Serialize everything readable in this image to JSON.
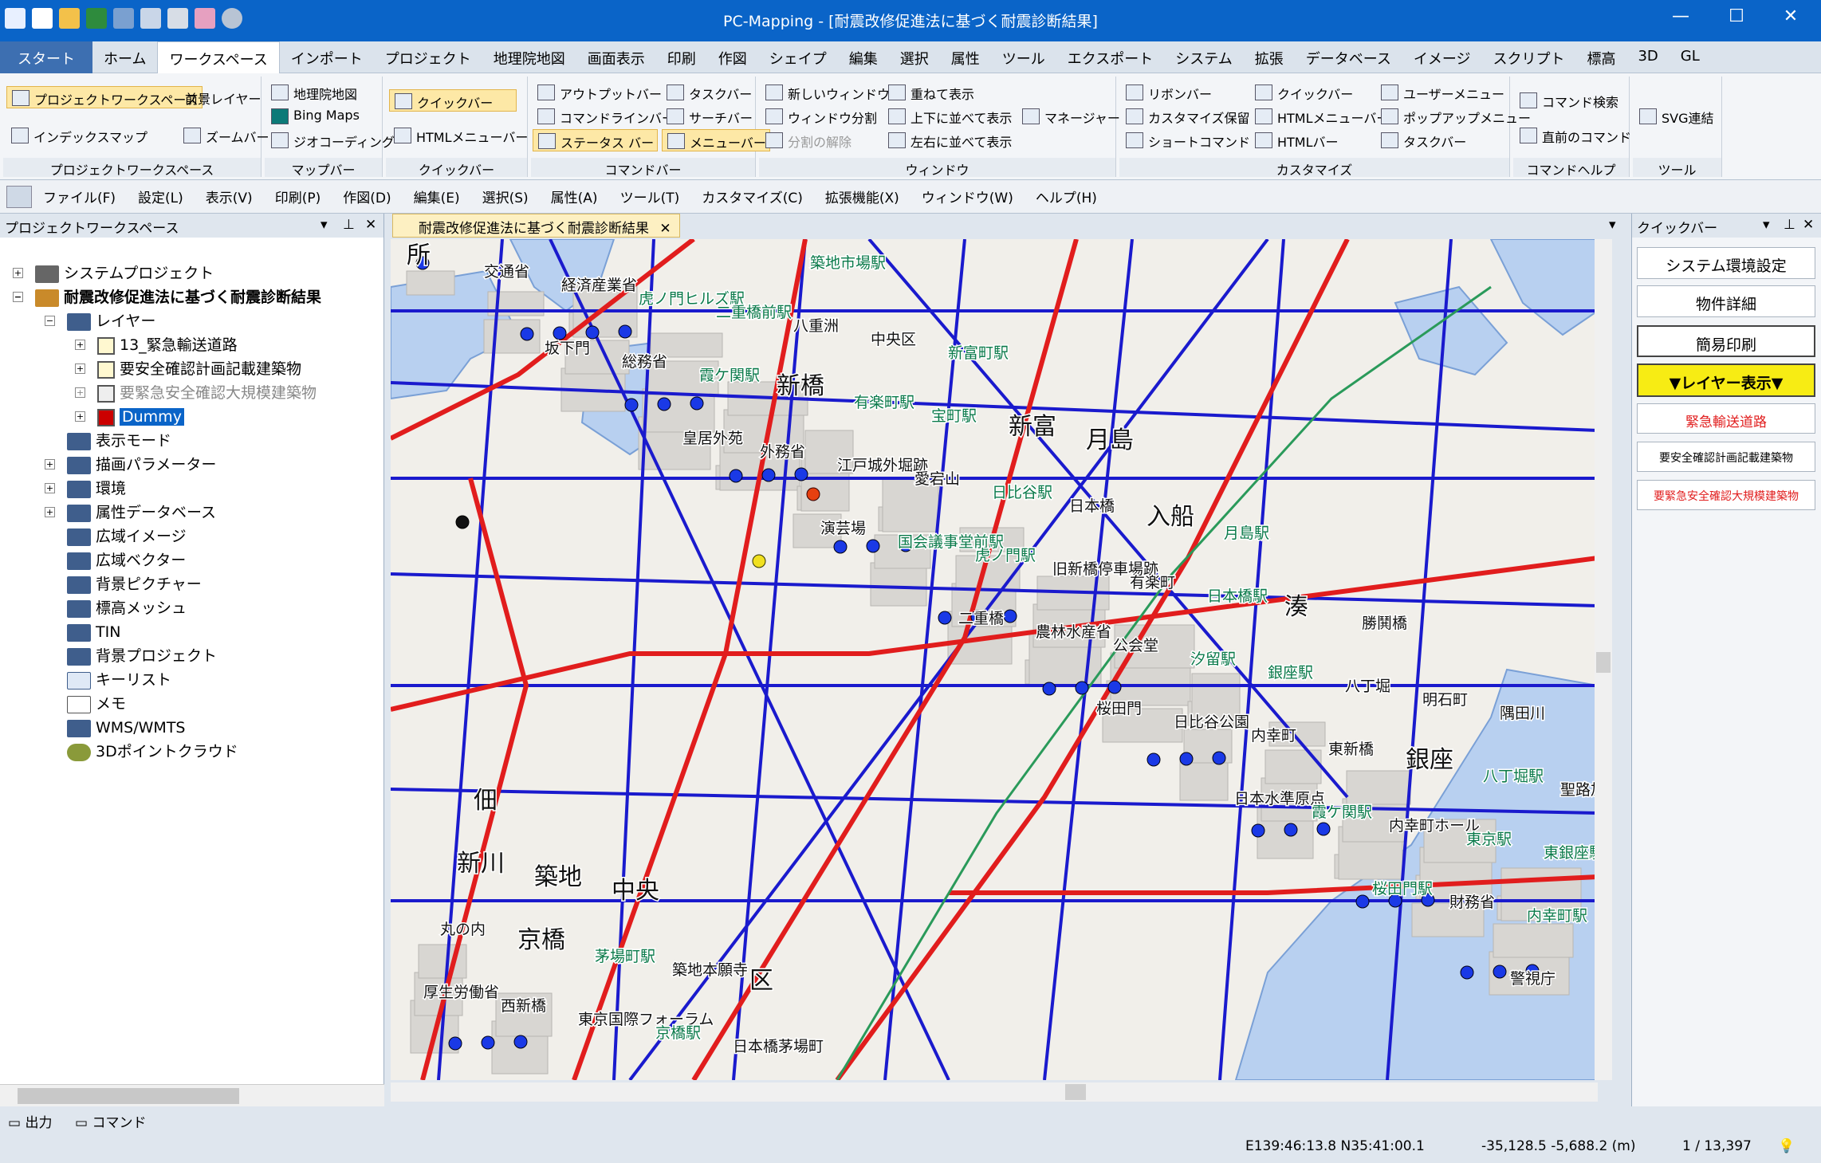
{
  "window": {
    "title": "PC-Mapping - [耐震改修促進法に基づく耐震診断結果]"
  },
  "ribbon_tabs": [
    "スタート",
    "ホーム",
    "ワークスペース",
    "インポート",
    "プロジェクト",
    "地理院地図",
    "画面表示",
    "印刷",
    "作図",
    "シェイプ",
    "編集",
    "選択",
    "属性",
    "ツール",
    "エクスポート",
    "システム",
    "拡張",
    "データベース",
    "イメージ",
    "スクリプト",
    "標高",
    "3D",
    "GL"
  ],
  "ribbon_active": "ワークスペース",
  "ribbon_groups": {
    "project_ws": {
      "label": "プロジェクトワークスペース",
      "b1": "プロジェクトワークスペース",
      "b2": "前景レイヤー",
      "b3": "インデックスマップ",
      "b4": "ズームバー"
    },
    "mapbar": {
      "label": "マップバー",
      "b1": "地理院地図",
      "b2": "Bing Maps",
      "b3": "ジオコーディング"
    },
    "quickbar": {
      "label": "クイックバー",
      "b1": "クイックバー",
      "b2": "HTMLメニューバー"
    },
    "commandbar": {
      "label": "コマンドバー",
      "b1": "アウトプットバー",
      "b2": "コマンドラインバー",
      "b3": "ステータス バー",
      "b4": "タスクバー",
      "b5": "サーチバー",
      "b6": "メニューバー"
    },
    "window": {
      "label": "ウィンドウ",
      "b1": "新しいウィンドウ",
      "b2": "ウィンドウ分割",
      "b3": "分割の解除",
      "b4": "重ねて表示",
      "b5": "上下に並べて表示",
      "b6": "左右に並べて表示",
      "b7": "マネージャー"
    },
    "customize": {
      "label": "カスタマイズ",
      "b1": "リボンバー",
      "b2": "カスタマイズ保留",
      "b3": "ショートコマンド",
      "b4": "クイックバー",
      "b5": "HTMLメニューバー",
      "b6": "HTMLバー",
      "b7": "ユーザーメニュー",
      "b8": "ポップアップメニュー",
      "b9": "タスクバー"
    },
    "cmdhelp": {
      "label": "コマンドヘルプ",
      "b1": "コマンド検索",
      "b2": "直前のコマンド"
    },
    "tool": {
      "label": "ツール",
      "b1": "SVG連結"
    }
  },
  "menubar": [
    "ファイル(F)",
    "設定(L)",
    "表示(V)",
    "印刷(P)",
    "作図(D)",
    "編集(E)",
    "選択(S)",
    "属性(A)",
    "ツール(T)",
    "カスタマイズ(C)",
    "拡張機能(X)",
    "ウィンドウ(W)",
    "ヘルプ(H)"
  ],
  "left_pane": {
    "title": "プロジェクトワークスペース",
    "tree": {
      "system": "システムプロジェクト",
      "project": "耐震改修促進法に基づく耐震診断結果",
      "layers": "レイヤー",
      "layer1": "13_緊急輸送道路",
      "layer2": "要安全確認計画記載建築物",
      "layer3": "要緊急安全確認大規模建築物",
      "layer4": "Dummy",
      "f1": "表示モード",
      "f2": "描画パラメーター",
      "f3": "環境",
      "f4": "属性データベース",
      "f5": "広域イメージ",
      "f6": "広域ベクター",
      "f7": "背景ピクチャー",
      "f8": "標高メッシュ",
      "f9": "TIN",
      "f10": "背景プロジェクト",
      "f11": "キーリスト",
      "f12": "メモ",
      "f13": "WMS/WMTS",
      "f14": "3Dポイントクラウド"
    }
  },
  "doc_tab": "耐震改修促進法に基づく耐震診断結果",
  "map_labels": [
    "所",
    "坂下門",
    "皇居外苑",
    "演芸場",
    "二重橋",
    "桜田門",
    "日本水準原点",
    "桜田門駅",
    "警視庁",
    "交通省",
    "総務省",
    "外務省",
    "国会議事堂前駅",
    "農林水産省",
    "日比谷公園",
    "霞ケ関駅",
    "財務省",
    "厚生労働省",
    "経済産業省",
    "霞ケ関駅",
    "江戸城外堀跡",
    "虎ノ門駅",
    "公会堂",
    "内幸町",
    "内幸町ホール",
    "内幸町駅",
    "西新橋",
    "虎ノ門ヒルズ駅",
    "新橋",
    "愛宕山",
    "旧新橋停車場跡",
    "汐留駅",
    "東新橋",
    "東京駅",
    "丸の内",
    "東京国際フォーラム",
    "二重橋前駅",
    "有楽町駅",
    "日比谷駅",
    "有楽町",
    "銀座駅",
    "銀座",
    "東銀座駅",
    "京橋",
    "京橋駅",
    "八重洲",
    "宝町駅",
    "日本橋",
    "日本橋駅",
    "八丁堀",
    "八丁堀駅",
    "新川",
    "茅場町駅",
    "日本橋茅場町",
    "中央区",
    "新富",
    "入船",
    "湊",
    "明石町",
    "聖路加国際大",
    "築地",
    "築地本願寺",
    "築地市場駅",
    "新富町駅",
    "月島",
    "月島駅",
    "勝鬨橋",
    "隅田川",
    "佃",
    "中央",
    "区"
  ],
  "quick_pane": {
    "title": "クイックバー",
    "b1": "システム環境設定",
    "b2": "物件詳細",
    "b3": "簡易印刷",
    "b4": "▼レイヤー表示▼",
    "b5": "緊急輸送道路",
    "b6": "要安全確認計画記載建築物",
    "b7": "要緊急安全確認大規模建築物"
  },
  "output_tabs": {
    "t1": "出力",
    "t2": "コマンド"
  },
  "status": {
    "coords": "E139:46:13.8 N35:41:00.1",
    "xy": "-35,128.5 -5,688.2 (m)",
    "scale": "1 / 13,397"
  },
  "colors": {
    "title_bar": "#0a64c8",
    "emergency_road": "#e11d1d",
    "road_blue": "#1a1acd",
    "water": "#b8d0f0",
    "marker_blue": "#1a39e6"
  }
}
